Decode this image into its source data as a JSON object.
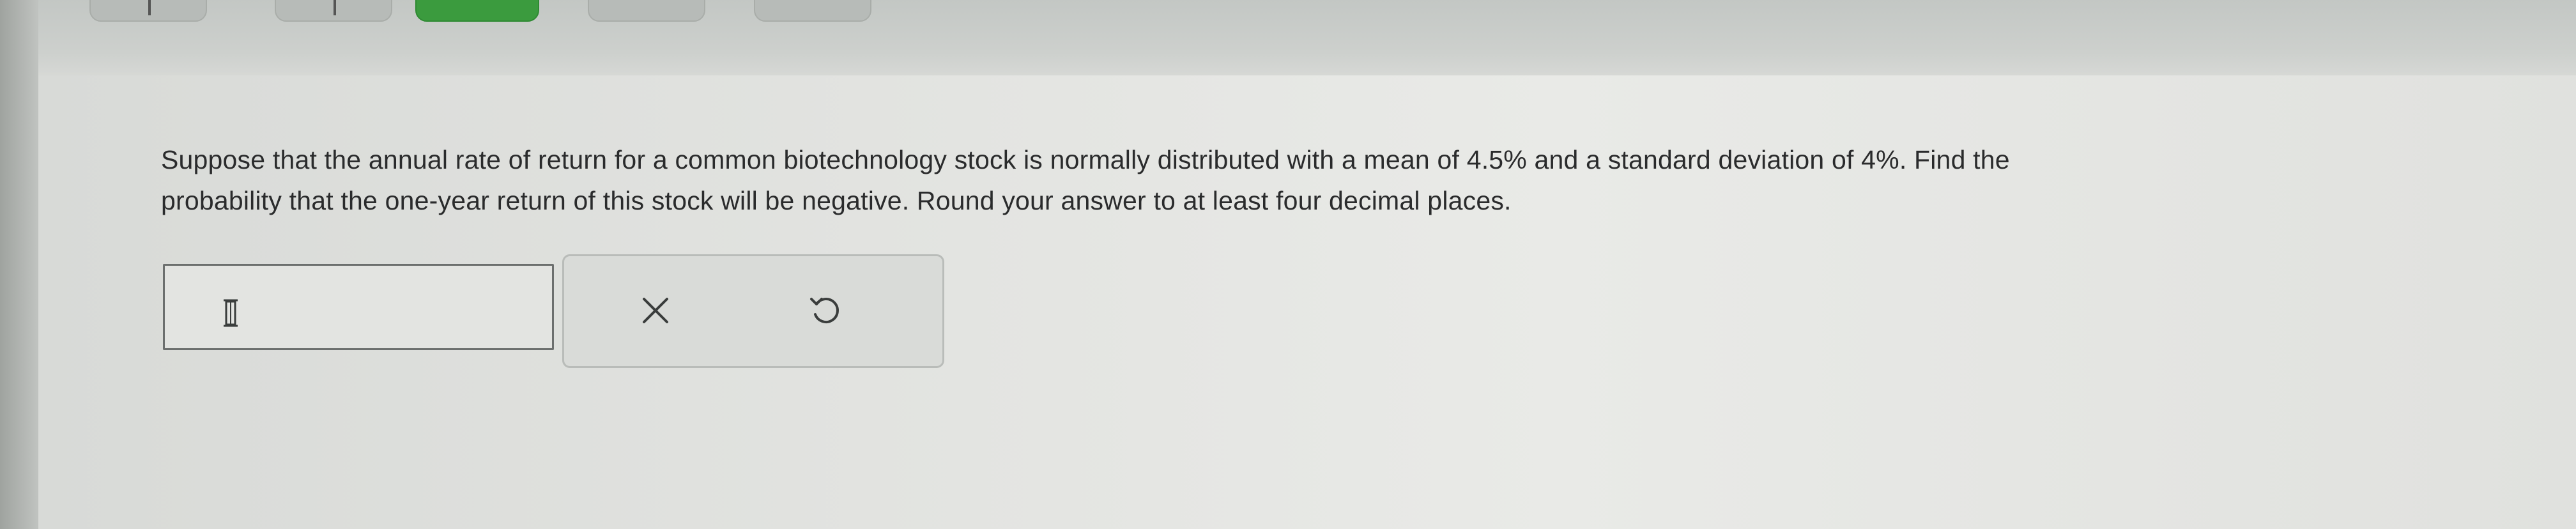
{
  "top_buttons": [
    {
      "icon": "partial-button"
    },
    {
      "icon": "partial-button"
    },
    {
      "icon": "partial-button-green",
      "color": "#3b9b3e"
    },
    {
      "icon": "partial-button"
    },
    {
      "icon": "partial-button"
    }
  ],
  "question": {
    "line1": "Suppose that the annual rate of return for a common biotechnology stock is normally distributed with a mean of 4.5% and a standard deviation of 4%. Find the",
    "line2": "probability that the one-year return of this stock will be negative. Round your answer to at least four decimal places."
  },
  "answer": {
    "value": "",
    "placeholder": ""
  },
  "tools": {
    "clear_icon": "close-icon",
    "undo_icon": "undo-icon"
  },
  "colors": {
    "accent_green": "#3b9b3e",
    "text": "#2a2b2c"
  }
}
